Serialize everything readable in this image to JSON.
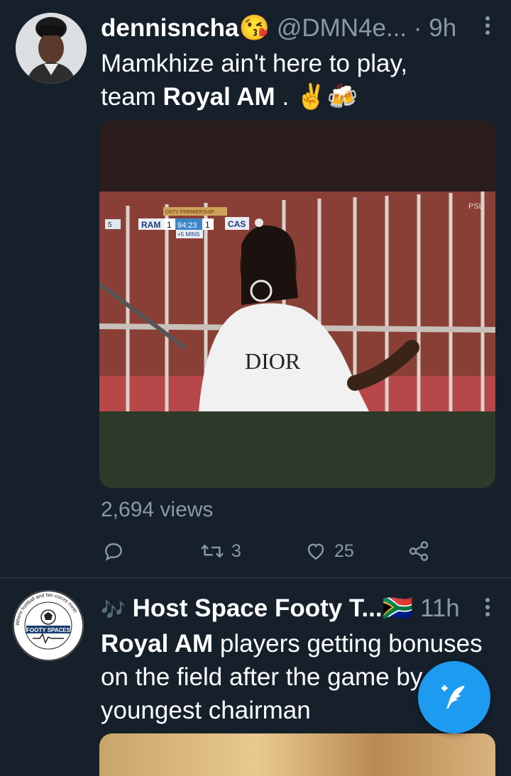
{
  "tweets": [
    {
      "display_name": "dennisncha",
      "name_emoji": "😘",
      "handle": "@DMN4e...",
      "time": "· 9h",
      "text_line1": "Mamkhize ain't here to play,",
      "text_line2_prefix": "team ",
      "text_line2_bold": "Royal AM",
      "text_line2_suffix": " . ✌️🍻",
      "media": {
        "scoreboard": {
          "competition": "DSTV PREMIERSHIP",
          "home": "RAM",
          "home_score": "1",
          "clock": "94:23",
          "away_score": "1",
          "away": "CAS",
          "added_time": "+5 MINS",
          "period": "5"
        },
        "broadcaster": "PSL",
        "shirt_text": "DIOR"
      },
      "views": "2,694 views",
      "actions": {
        "retweets": "3",
        "likes": "25"
      }
    },
    {
      "display_name_prefix": "🎶",
      "display_name": "Host Space Footy T...",
      "flag_emoji": "🇿🇦",
      "time": "11h",
      "avatar_text": "FOOTY SPACES",
      "avatar_ring_text": "Where football and fan voices meet",
      "text_line1_bold": "Royal AM",
      "text_line1_rest": " players getting bonuses",
      "text_line2": "on the field after the game by",
      "text_line3": "youngest chairman"
    }
  ],
  "fab": {
    "icon": "compose-tweet-icon"
  },
  "colors": {
    "background": "#15202b",
    "muted_text": "#8b98a5",
    "accent": "#1d9bf0",
    "divider": "#38444d"
  }
}
